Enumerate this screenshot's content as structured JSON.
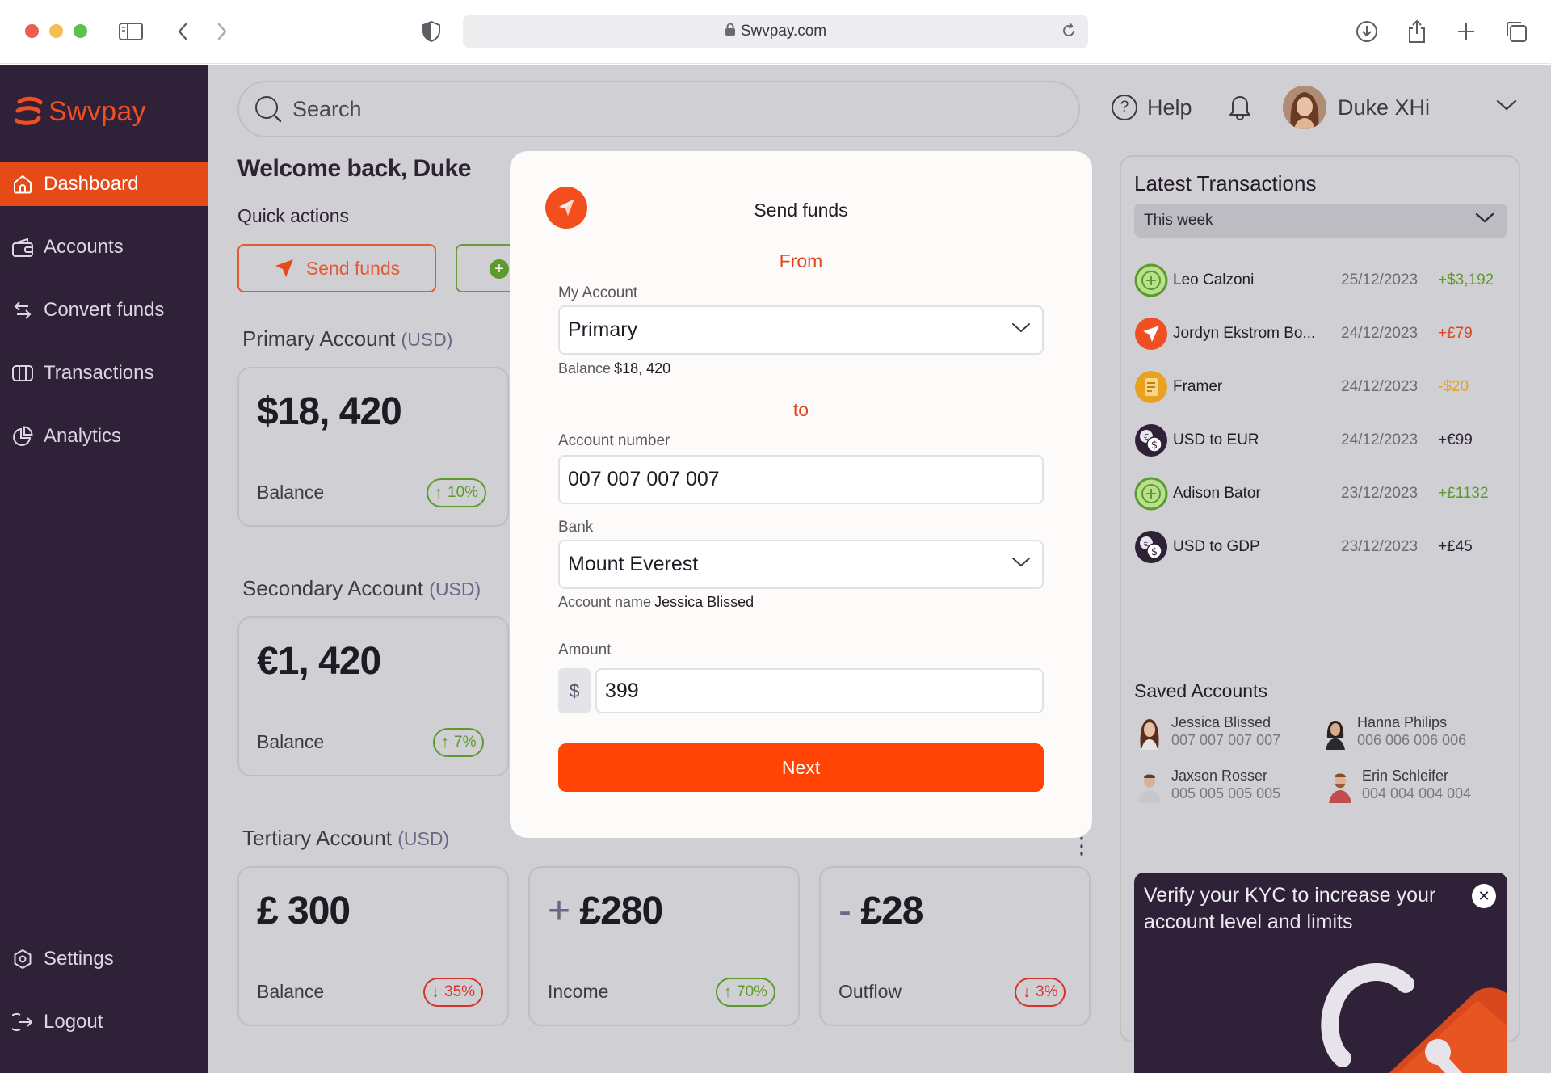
{
  "browser": {
    "url": "Swvpay.com"
  },
  "colors": {
    "brand": "#f04e23",
    "sidebar_bg": "#2f2137",
    "positive": "#5d9a2c",
    "negative": "#d6352b",
    "warning": "#e8a21d",
    "primary_button": "#ff4405"
  },
  "sidebar": {
    "logo_text": "Swvpay",
    "nav": [
      {
        "label": "Dashboard",
        "icon": "home-icon",
        "active": true
      },
      {
        "label": "Accounts",
        "icon": "wallet-icon"
      },
      {
        "label": "Convert funds",
        "icon": "convert-icon"
      },
      {
        "label": "Transactions",
        "icon": "transactions-icon"
      },
      {
        "label": "Analytics",
        "icon": "pie-chart-icon"
      }
    ],
    "bottom": [
      {
        "label": "Settings",
        "icon": "gear-icon"
      },
      {
        "label": "Logout",
        "icon": "logout-icon"
      }
    ]
  },
  "header": {
    "search_placeholder": "Search",
    "help": "Help",
    "user_name": "Duke XHi"
  },
  "dashboard": {
    "welcome": "Welcome back, Duke",
    "quick_actions": "Quick actions",
    "send_funds": "Send funds",
    "primary": {
      "title": "Primary Account",
      "currency": "(USD)",
      "amount": "$18, 420",
      "label": "Balance",
      "change": "10%"
    },
    "secondary": {
      "title": "Secondary Account",
      "currency": "(USD)",
      "amount": "€1, 420",
      "label": "Balance",
      "change": "7%"
    },
    "tertiary": {
      "title": "Tertiary Account",
      "currency": "(USD)",
      "cards": [
        {
          "sign": "",
          "amount": "£ 300",
          "label": "Balance",
          "change": "35%"
        },
        {
          "sign": "+",
          "amount": "£280",
          "label": "Income",
          "change": "70%"
        },
        {
          "sign": "-",
          "amount": "£28",
          "label": "Outflow",
          "change": "3%"
        }
      ]
    }
  },
  "transactions": {
    "title": "Latest Transactions",
    "filter": "This week",
    "items": [
      {
        "name": "Leo Calzoni",
        "date": "25/12/2023",
        "amount": "+$3,192",
        "icon": "plus-circle-icon"
      },
      {
        "name": "Jordyn Ekstrom Bo...",
        "date": "24/12/2023",
        "amount": "+£79",
        "icon": "send-icon"
      },
      {
        "name": "Framer",
        "date": "24/12/2023",
        "amount": "-$20",
        "icon": "receipt-icon"
      },
      {
        "name": "USD to EUR",
        "date": "24/12/2023",
        "amount": "+€99",
        "icon": "exchange-icon"
      },
      {
        "name": "Adison Bator",
        "date": "23/12/2023",
        "amount": "+£1132",
        "icon": "plus-circle-icon"
      },
      {
        "name": "USD to GDP",
        "date": "23/12/2023",
        "amount": "+£45",
        "icon": "exchange-icon"
      }
    ]
  },
  "saved_accounts": {
    "title": "Saved Accounts",
    "items": [
      {
        "name": "Jessica Blissed",
        "number": "007 007 007 007"
      },
      {
        "name": "Hanna Philips",
        "number": "006 006 006 006"
      },
      {
        "name": "Jaxson Rosser",
        "number": "005 005 005 005"
      },
      {
        "name": "Erin Schleifer",
        "number": "004 004 004 004"
      }
    ]
  },
  "kyc": {
    "text": "Verify your KYC to increase your account level and limits"
  },
  "modal": {
    "title": "Send funds",
    "from": "From",
    "my_account_label": "My Account",
    "my_account_value": "Primary",
    "balance_label": "Balance",
    "balance_value": "$18, 420",
    "to": "to",
    "account_number_label": "Account number",
    "account_number_value": "007 007 007 007",
    "bank_label": "Bank",
    "bank_value": "Mount Everest",
    "account_name_label": "Account name",
    "account_name_value": "Jessica Blissed",
    "amount_label": "Amount",
    "amount_prefix": "$",
    "amount_value": "399",
    "next": "Next"
  }
}
